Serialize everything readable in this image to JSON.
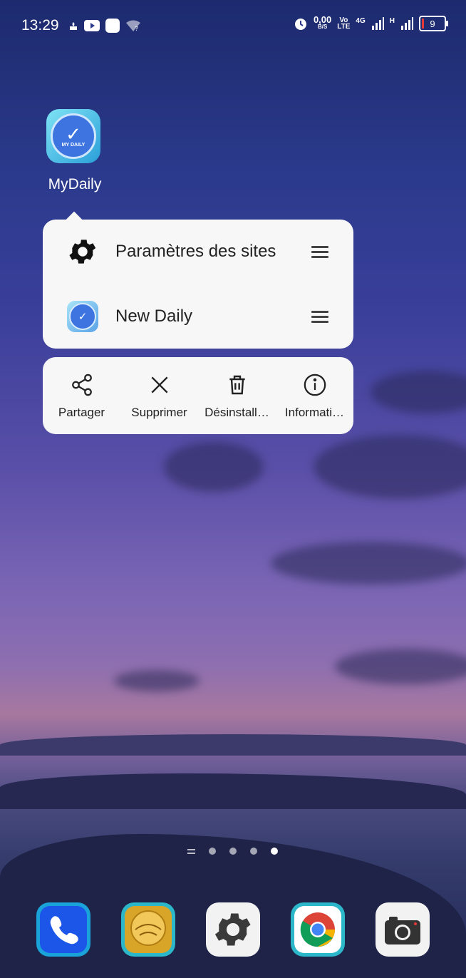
{
  "status_bar": {
    "time": "13:29",
    "net_speed_value": "0,00",
    "net_speed_unit": "B/S",
    "volte_top": "Vo",
    "volte_bottom": "LTE",
    "net_4g": "4G",
    "net_h": "H",
    "battery": "9"
  },
  "app": {
    "label": "MyDaily",
    "icon_text": "MY DAILY"
  },
  "shortcut_menu": {
    "items": [
      {
        "label": "Paramètres des sites",
        "icon": "gear-icon"
      },
      {
        "label": "New Daily",
        "icon": "app-icon"
      }
    ]
  },
  "actions": [
    {
      "label": "Partager",
      "icon": "share-icon"
    },
    {
      "label": "Supprimer",
      "icon": "close-icon"
    },
    {
      "label": "Désinstall…",
      "icon": "trash-icon"
    },
    {
      "label": "Informati…",
      "icon": "info-icon"
    }
  ],
  "dock": [
    {
      "name": "phone",
      "icon": "phone-icon"
    },
    {
      "name": "quran",
      "icon": "quran-icon"
    },
    {
      "name": "settings",
      "icon": "gear-icon"
    },
    {
      "name": "chrome",
      "icon": "chrome-icon"
    },
    {
      "name": "camera",
      "icon": "camera-icon"
    }
  ],
  "colors": {
    "menu_bg": "#f7f7f8",
    "battery_low": "#e53935"
  }
}
